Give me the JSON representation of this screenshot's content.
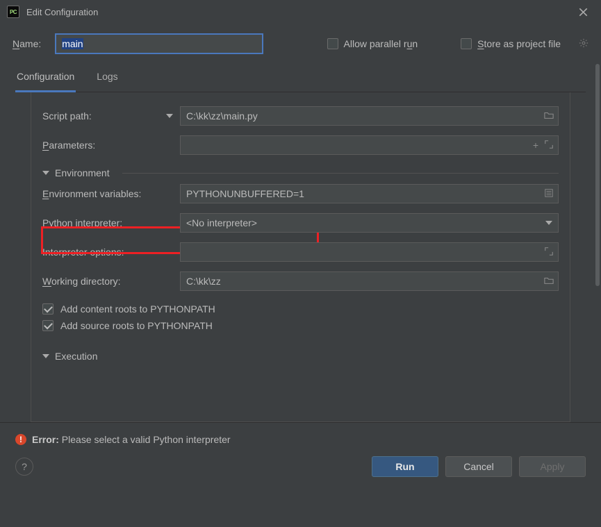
{
  "window": {
    "title": "Edit Configuration"
  },
  "name_row": {
    "label_pre": "N",
    "label_rest": "ame:",
    "value": "main"
  },
  "options": {
    "allow_parallel_pre": "Allow parallel r",
    "allow_parallel_u": "u",
    "allow_parallel_post": "n",
    "store_pre": "S",
    "store_rest": "tore as project file"
  },
  "tabs": {
    "configuration": "Configuration",
    "logs": "Logs"
  },
  "form": {
    "script_path_label": "Script path:",
    "script_path_value": "C:\\kk\\zz\\main.py",
    "parameters_label_u": "P",
    "parameters_label_rest": "arameters:",
    "env_section": "Environment",
    "env_vars_label_u": "E",
    "env_vars_label_rest": "nvironment variables:",
    "env_vars_value": "PYTHONUNBUFFERED=1",
    "interpreter_label_u": "P",
    "interpreter_label_rest": "ython interpreter:",
    "interpreter_value": "<No interpreter>",
    "interp_opts_label": "Interpreter options:",
    "workdir_label_u": "W",
    "workdir_label_rest": "orking directory:",
    "workdir_value": "C:\\kk\\zz",
    "content_roots": "Add content roots to PYTHONPATH",
    "source_roots": "Add source roots to PYTHONPATH",
    "execution_section": "Execution"
  },
  "error": {
    "label": "Error:",
    "msg": " Please select a valid Python interpreter"
  },
  "buttons": {
    "run": "Run",
    "cancel": "Cancel",
    "apply": "Apply"
  }
}
